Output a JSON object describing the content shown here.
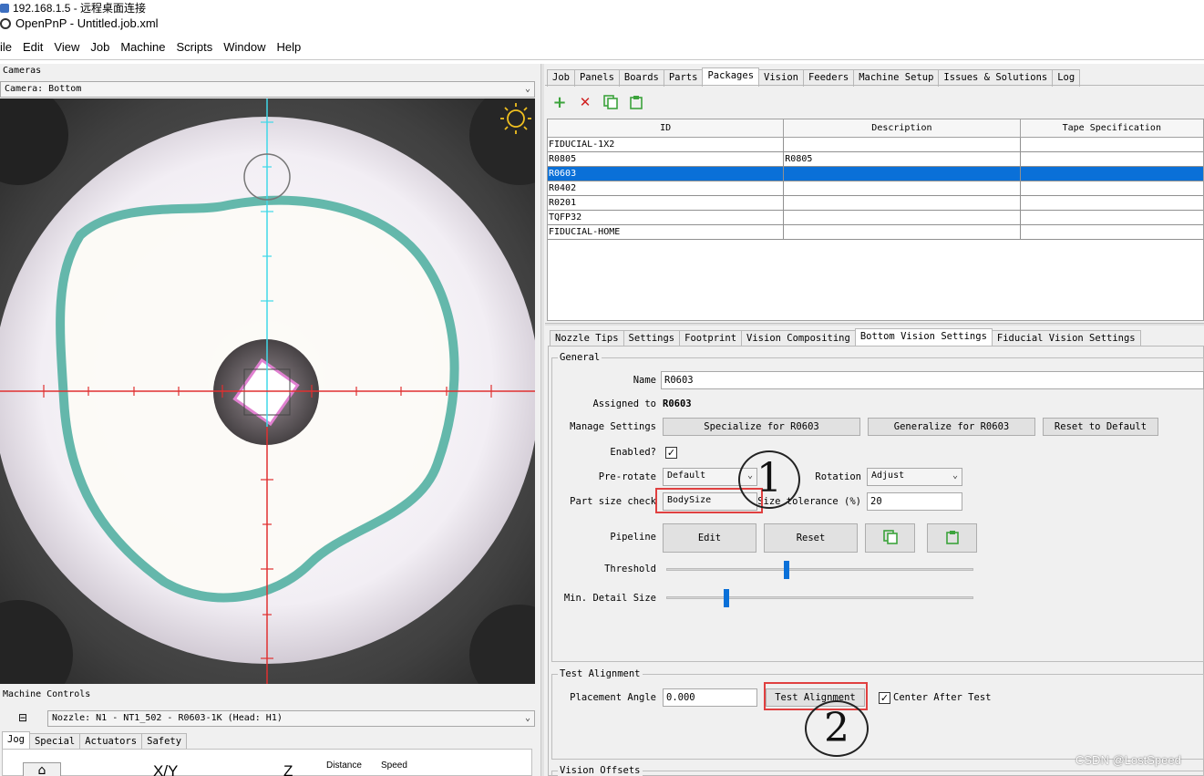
{
  "rdp_title": "192.168.1.5 - 远程桌面连接",
  "app_title": "OpenPnP - Untitled.job.xml",
  "menu": [
    "ile",
    "Edit",
    "View",
    "Job",
    "Machine",
    "Scripts",
    "Window",
    "Help"
  ],
  "cameras": {
    "section_label": "Cameras",
    "selected_camera": "Camera: Bottom"
  },
  "machine_controls": {
    "section_label": "Machine Controls",
    "nozzle": "Nozzle: N1 - NT1_502 - R0603-1K (Head: H1)",
    "tabs": [
      "Jog",
      "Special",
      "Actuators",
      "Safety"
    ],
    "active_tab": "Jog",
    "jog_labels": {
      "xy": "X/Y",
      "z": "Z",
      "distance": "Distance",
      "speed": "Speed"
    }
  },
  "main_tabs": [
    "Job",
    "Panels",
    "Boards",
    "Parts",
    "Packages",
    "Vision",
    "Feeders",
    "Machine Setup",
    "Issues & Solutions",
    "Log"
  ],
  "active_main_tab": "Packages",
  "toolbar": {
    "add": "+",
    "remove": "✕"
  },
  "packages_table": {
    "columns": [
      "ID",
      "Description",
      "Tape Specification"
    ],
    "rows": [
      [
        "FIDUCIAL-1X2",
        "",
        ""
      ],
      [
        "R0805",
        "R0805",
        ""
      ],
      [
        "R0603",
        "",
        ""
      ],
      [
        "R0402",
        "",
        ""
      ],
      [
        "R0201",
        "",
        ""
      ],
      [
        "TQFP32",
        "",
        ""
      ],
      [
        "FIDUCIAL-HOME",
        "",
        ""
      ]
    ],
    "selected_row": 2
  },
  "sub_tabs": [
    "Nozzle Tips",
    "Settings",
    "Footprint",
    "Vision Compositing",
    "Bottom Vision Settings",
    "Fiducial Vision Settings"
  ],
  "active_sub_tab": "Bottom Vision Settings",
  "general": {
    "title": "General",
    "name_label": "Name",
    "name_value": "R0603",
    "assigned_label": "Assigned to",
    "assigned_value": "R0603",
    "manage_label": "Manage Settings",
    "specialize_btn": "Specialize for  R0603",
    "generalize_btn": "Generalize for R0603",
    "reset_default_btn": "Reset to Default",
    "enabled_label": "Enabled?",
    "enabled_value": "✓",
    "prerotate_label": "Pre-rotate",
    "prerotate_value": "Default",
    "rotation_label": "Rotation",
    "rotation_value": "Adjust",
    "partsize_label": "Part size check",
    "partsize_value": "BodySize",
    "sizetol_label": "Size tolerance (%)",
    "sizetol_value": "20",
    "pipeline_label": "Pipeline",
    "edit_btn": "Edit",
    "reset_btn": "Reset",
    "threshold_label": "Threshold",
    "threshold_level": 0.39,
    "mindetail_label": "Min. Detail Size",
    "mindetail_level": 0.19
  },
  "test_alignment": {
    "title": "Test Alignment",
    "angle_label": "Placement Angle",
    "angle_value": "0.000",
    "test_btn": "Test Alignment",
    "center_label": "Center After Test",
    "center_checked": "✓"
  },
  "vision_offsets_title": "Vision Offsets",
  "annotations": {
    "one": "1",
    "two": "2"
  },
  "watermark": "CSDN @LostSpeed",
  "colors": {
    "selection": "#0a70d8",
    "highlight_box": "#e04040",
    "crosshair_red": "#e03030",
    "crosshair_cyan": "#40d8e8"
  }
}
